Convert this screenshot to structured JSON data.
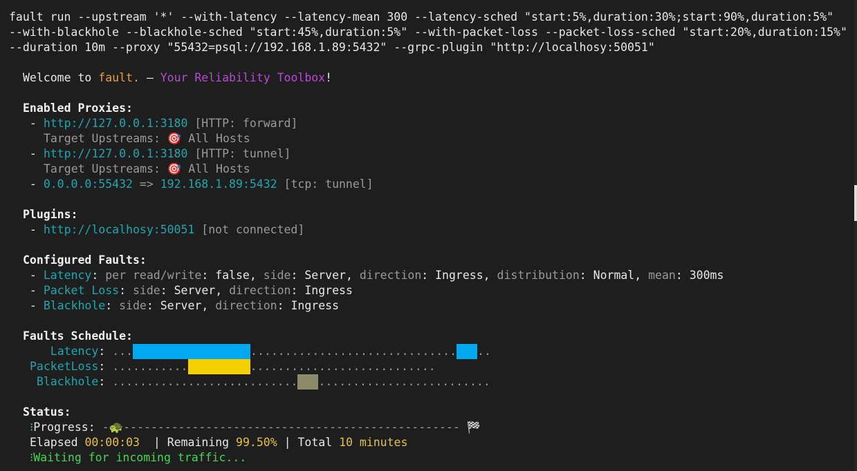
{
  "command": {
    "line1": "fault run --upstream '*' --with-latency --latency-mean 300 --latency-sched \"start:5%,duration:30%;start:90%,duration:5%\"",
    "line2": "--with-blackhole --blackhole-sched \"start:45%,duration:5%\" --with-packet-loss --packet-loss-sched \"start:20%,duration:15%\"",
    "line3": "--duration 10m --proxy \"55432=psql://192.168.1.89:5432\" --grpc-plugin \"http://localhosy:50051\""
  },
  "welcome": {
    "prefix": "Welcome to ",
    "brand": "fault.",
    "dash": " — ",
    "tagline": "Your Reliability Toolbox",
    "suffix": "!"
  },
  "proxies": {
    "heading": "Enabled Proxies:",
    "items": [
      {
        "bullet": " - ",
        "url": "http://127.0.0.1:3180",
        "tag": " [HTTP: forward]",
        "target_label": "Target Upstreams: ",
        "target_icon": "🎯",
        "target_value": " All Hosts"
      },
      {
        "bullet": " - ",
        "url": "http://127.0.0.1:3180",
        "tag": " [HTTP: tunnel]",
        "target_label": "Target Upstreams: ",
        "target_icon": "🎯",
        "target_value": " All Hosts"
      }
    ],
    "tcp": {
      "bullet": " - ",
      "from": "0.0.0.0:55432",
      "arrow": " => ",
      "to": "192.168.1.89:5432",
      "tag": " [tcp: tunnel]"
    }
  },
  "plugins": {
    "heading": "Plugins:",
    "items": [
      {
        "bullet": " - ",
        "url": "http://localhosy:50051",
        "status": " [not connected]"
      }
    ]
  },
  "faults": {
    "heading": "Configured Faults:",
    "latency": {
      "name": "Latency",
      "k1": "per read/write",
      "v1": "false",
      "k2": "side",
      "v2": "Server",
      "k3": "direction",
      "v3": "Ingress",
      "k4": "distribution",
      "v4": "Normal",
      "k5": "mean",
      "v5": "300ms"
    },
    "packet_loss": {
      "name": "Packet Loss",
      "k1": "side",
      "v1": "Server",
      "k2": "direction",
      "v2": "Ingress"
    },
    "blackhole": {
      "name": "Blackhole",
      "k1": "side",
      "v1": "Server",
      "k2": "direction",
      "v2": "Ingress"
    }
  },
  "schedule": {
    "heading": "Faults Schedule:",
    "rows": [
      {
        "label": "   Latency",
        "colon": ": ",
        "pre": "...",
        "bar_color": "#00a8f0",
        "mid": "..............................",
        "bar2_color": "#00a8f0",
        "post": ".."
      },
      {
        "label": "PacketLoss",
        "colon": ": ",
        "pre": "...........",
        "bar_color": "#f5d000",
        "post": "..........................."
      },
      {
        "label": " Blackhole",
        "colon": ": ",
        "pre": "...........................",
        "bar_color": "#8b8b6a",
        "post": "........................."
      }
    ]
  },
  "status": {
    "heading": "Status:",
    "progress_label": "Progress: ",
    "progress_fraction": 0.005,
    "progress_start": "-",
    "progress_icon": "🐢",
    "progress_track": "------------------------------------------------- ",
    "progress_end_icon": "🏁",
    "elapsed_label": "Elapsed ",
    "elapsed": "00:00:03",
    "remaining_label": "  | Remaining ",
    "remaining": "99.50%",
    "total_label": " | Total ",
    "total": "10 minutes",
    "waiting": "Waiting for incoming traffic..."
  }
}
